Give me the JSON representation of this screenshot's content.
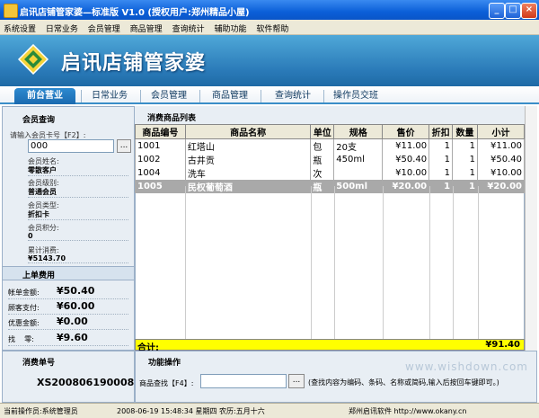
{
  "window": {
    "title": "启讯店铺管家婆—标准版 V1.0 (授权用户:郑州精品小屋)",
    "min": "_",
    "max": "□",
    "close": "×"
  },
  "menu": [
    "系统设置",
    "日常业务",
    "会员管理",
    "商品管理",
    "查询统计",
    "辅助功能",
    "软件帮助"
  ],
  "banner": {
    "title": "启讯店铺管家婆"
  },
  "tabs": [
    "前台营业",
    "日常业务",
    "会员管理",
    "商品管理",
    "查询统计",
    "操作员交班"
  ],
  "member": {
    "section_title": "会员查询",
    "card_label": "请输入会员卡号【F2】:",
    "card_value": "000",
    "browse": "...",
    "name_label": "会员姓名:",
    "name_value": "零散客户",
    "level_label": "会员级别:",
    "level_value": "普通会员",
    "type_label": "会员类型:",
    "type_value": "折扣卡",
    "points_label": "会员积分:",
    "points_value": "0",
    "total_label": "累计消费:",
    "total_value": "¥5143.70"
  },
  "bill": {
    "section_title": "上单费用",
    "amount_label": "帐单金额:",
    "amount_value": "¥50.40",
    "paid_label": "顾客支付:",
    "paid_value": "¥60.00",
    "discount_label": "优惠金额:",
    "discount_value": "¥0.00",
    "change_label": "找    零:",
    "change_value": "¥9.60"
  },
  "order": {
    "section_title": "消费单号",
    "number": "XS200806190008"
  },
  "list": {
    "section_title": "消费商品列表",
    "columns": [
      "商品编号",
      "商品名称",
      "单位",
      "规格",
      "售价",
      "折扣",
      "数量",
      "小计"
    ],
    "rows": [
      [
        "1001",
        "红塔山",
        "包",
        "20支",
        "¥11.00",
        "1",
        "1",
        "¥11.00"
      ],
      [
        "1002",
        "古井贡",
        "瓶",
        "450ml",
        "¥50.40",
        "1",
        "1",
        "¥50.40"
      ],
      [
        "1004",
        "洗车",
        "次",
        "",
        "¥10.00",
        "1",
        "1",
        "¥10.00"
      ],
      [
        "1005",
        "民权葡萄酒",
        "瓶",
        "500ml",
        "¥20.00",
        "1",
        "1",
        "¥20.00"
      ]
    ],
    "total_label": "合计:",
    "total_value": "¥91.40"
  },
  "function": {
    "section_title": "功能操作",
    "search_label": "商品查找【F4】:",
    "search_value": "",
    "browse": "...",
    "hint": "(查找内容为编码、条码、名称或简码,输入后按回车键即可。)"
  },
  "watermark": "www.wishdown.com",
  "status": {
    "operator": "当前操作员:系统管理员",
    "datetime": "2008-06-19 15:48:34 星期四 农历:五月十六",
    "company": "郑州启讯软件 http://www.okany.cn"
  },
  "colors": {
    "accent": "#1a6ab0",
    "total_bg": "#ffff00",
    "selected_row": "#a9a9a9"
  }
}
